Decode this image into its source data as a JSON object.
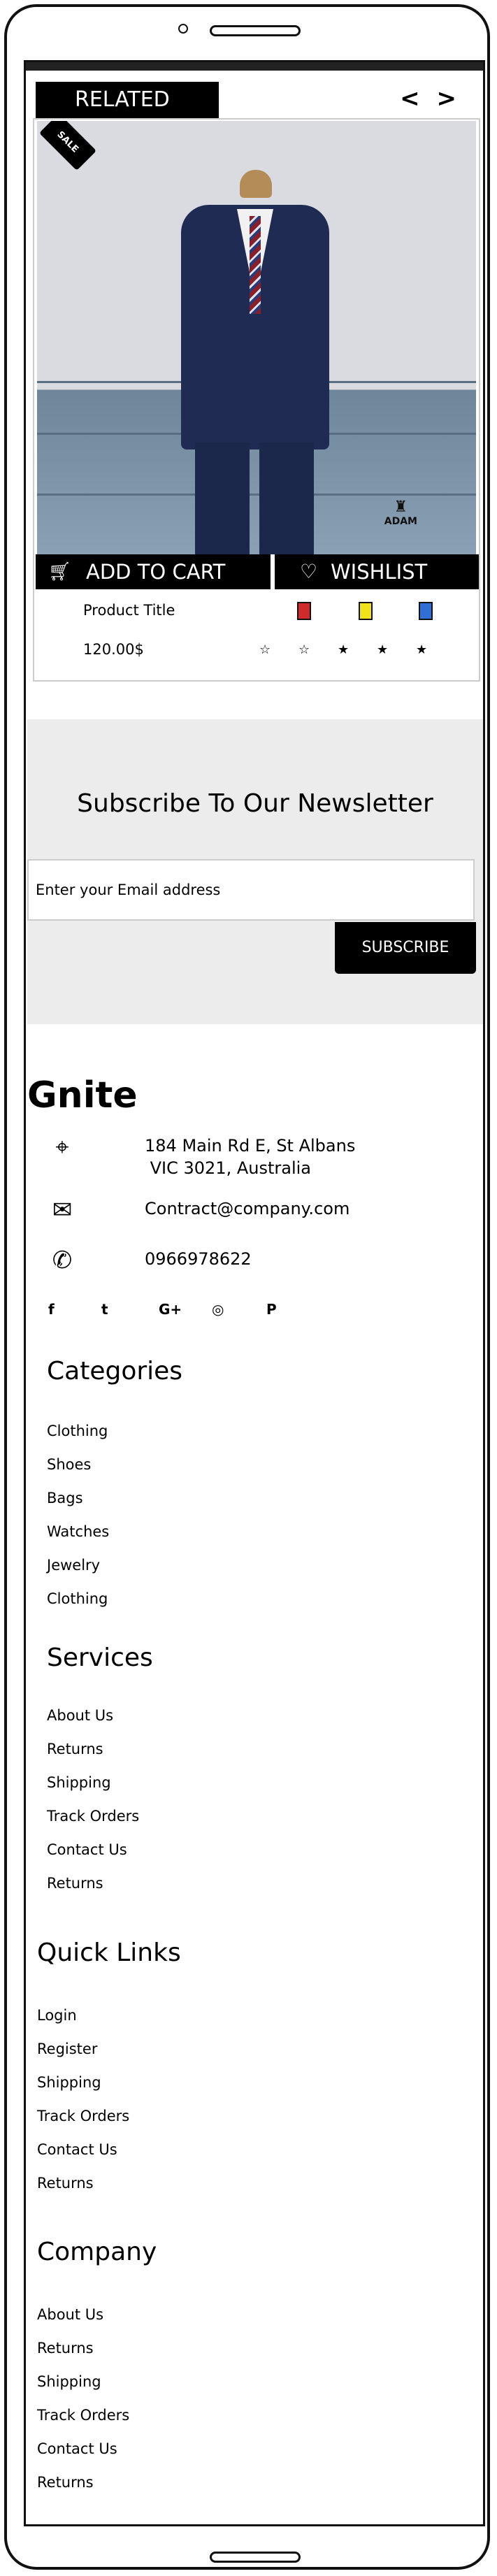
{
  "related": {
    "label": "RELATED",
    "prev": "<",
    "next": ">"
  },
  "product": {
    "sale_label": "SALE",
    "brand": "ADAM",
    "add_to_cart": "ADD TO CART",
    "wishlist": "WISHLIST",
    "title": "Product Title",
    "price": "120.00$",
    "swatches": [
      "#d12a2a",
      "#f2e21a",
      "#2f6fd6"
    ],
    "rating": {
      "value": 3,
      "max": 5,
      "stars": [
        "☆",
        "☆",
        "★",
        "★",
        "★"
      ]
    }
  },
  "newsletter": {
    "title": "Subscribe To Our Newsletter",
    "placeholder": "Enter your Email address",
    "button": "SUBSCRIBE"
  },
  "footer": {
    "brand": "Gnite",
    "address": "184 Main Rd E, St Albans\n VIC 3021, Australia",
    "email": "Contract@company.com",
    "phone": "0966978622",
    "socials": [
      "f",
      "t",
      "G+",
      "◎",
      "P"
    ],
    "categories": {
      "title": "Categories",
      "items": [
        "Clothing",
        "Shoes",
        "Bags",
        "Watches",
        "Jewelry",
        "Clothing"
      ]
    },
    "services": {
      "title": "Services",
      "items": [
        "About Us",
        "Returns",
        "Shipping",
        "Track Orders",
        "Contact Us",
        "Returns"
      ]
    },
    "quick_links": {
      "title": "Quick Links",
      "items": [
        "Login",
        "Register",
        "Shipping",
        "Track Orders",
        "Contact Us",
        "Returns"
      ]
    },
    "company": {
      "title": "Company",
      "items": [
        "About Us",
        "Returns",
        "Shipping",
        "Track Orders",
        "Contact Us",
        "Returns"
      ]
    }
  }
}
